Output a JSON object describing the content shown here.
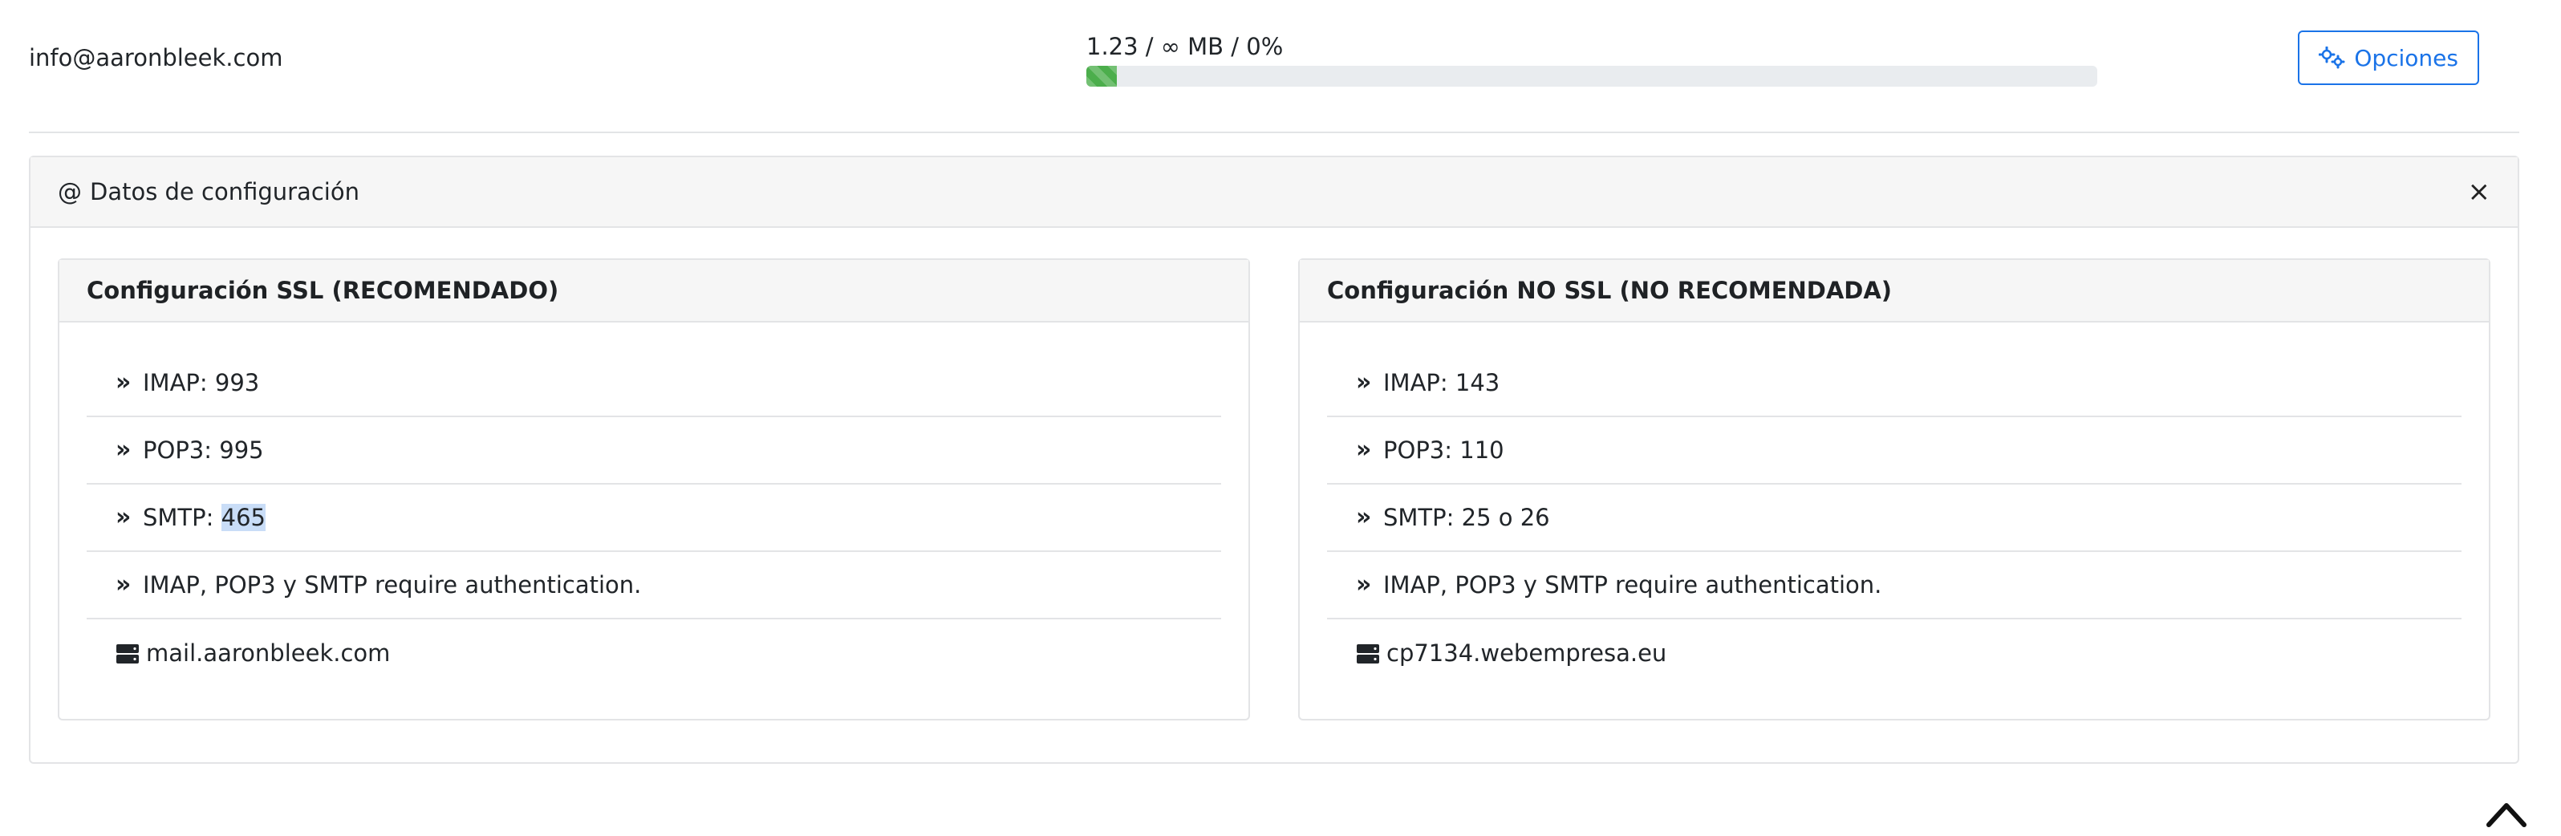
{
  "account": {
    "email": "info@aaronbleek.com"
  },
  "usage": {
    "text": "1.23 / ∞ MB / 0%",
    "progress_percent": 0.03,
    "bar_color": "#4cae4c"
  },
  "options_button": {
    "label": "Opciones",
    "icon": "gears-icon",
    "color": "#1a73e8"
  },
  "config": {
    "icon": "at-icon",
    "at_symbol": "@",
    "title": "Datos de configuración",
    "close_symbol": "×",
    "ssl": {
      "title": "Configuración SSL (RECOMENDADO)",
      "imap": "IMAP: 993",
      "pop3": "POP3: 995",
      "smtp_prefix": "SMTP: ",
      "smtp_value": "465",
      "auth": "IMAP, POP3 y SMTP require authentication.",
      "server": "mail.aaronbleek.com"
    },
    "nossl": {
      "title": "Configuración NO SSL (NO RECOMENDADA)",
      "imap": "IMAP: 143",
      "pop3": "POP3: 110",
      "smtp": "SMTP: 25 o 26",
      "auth": "IMAP, POP3 y SMTP require authentication.",
      "server": "cp7134.webempresa.eu"
    }
  },
  "icons": {
    "chevron": "»"
  }
}
